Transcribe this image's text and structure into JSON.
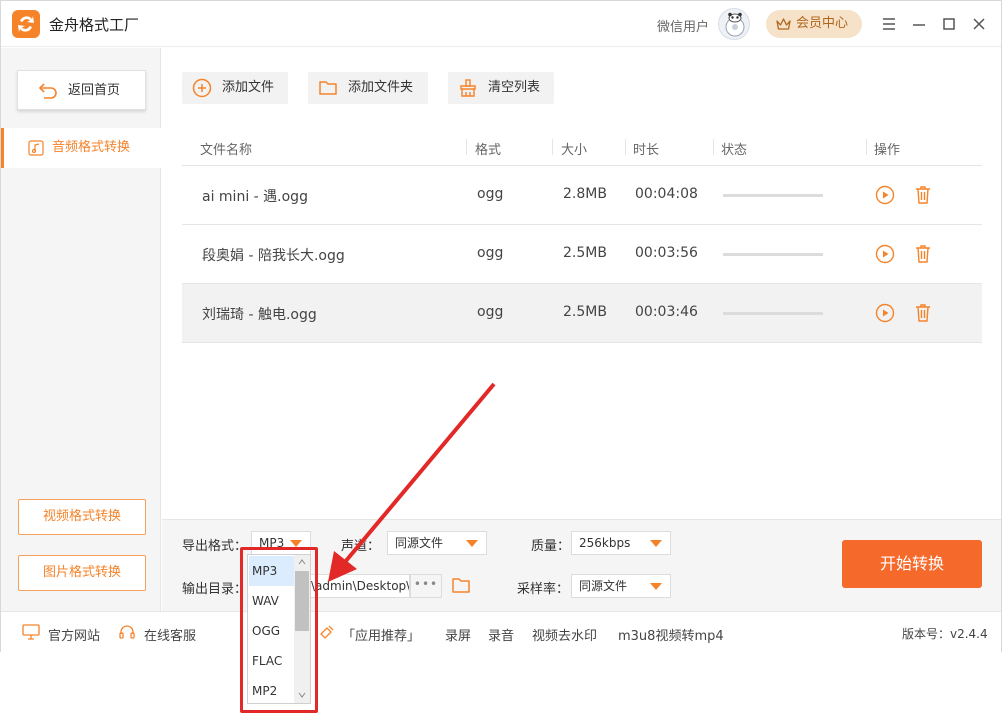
{
  "app": {
    "title": "金舟格式工厂",
    "user_name": "微信用户",
    "vip_label": "会员中心"
  },
  "sidebar": {
    "back_label": "返回首页",
    "active_label": "音频格式转换",
    "video_label": "视频格式转换",
    "image_label": "图片格式转换"
  },
  "toolbar": {
    "add_file": "添加文件",
    "add_folder": "添加文件夹",
    "clear_list": "清空列表"
  },
  "table": {
    "headers": {
      "name": "文件名称",
      "format": "格式",
      "size": "大小",
      "duration": "时长",
      "status": "状态",
      "actions": "操作"
    },
    "rows": [
      {
        "name": "ai mini - 遇.ogg",
        "format": "ogg",
        "size": "2.8MB",
        "duration": "00:04:08"
      },
      {
        "name": "段奥娟 - 陪我长大.ogg",
        "format": "ogg",
        "size": "2.5MB",
        "duration": "00:03:56"
      },
      {
        "name": "刘瑞琦 - 触电.ogg",
        "format": "ogg",
        "size": "2.5MB",
        "duration": "00:03:46"
      }
    ]
  },
  "settings": {
    "output_format_label": "导出格式：",
    "output_format_value": "MP3",
    "channel_label": "声道：",
    "channel_value": "同源文件",
    "quality_label": "质量：",
    "quality_value": "256kbps",
    "output_dir_label": "输出目录：",
    "output_dir_value": "\\admin\\Desktop\\",
    "sample_rate_label": "采样率：",
    "sample_rate_value": "同源文件",
    "start_label": "开始转换"
  },
  "format_dropdown": {
    "options": [
      "MP3",
      "WAV",
      "OGG",
      "FLAC",
      "MP2"
    ],
    "selected": "MP3"
  },
  "footer": {
    "website": "官方网站",
    "service": "在线客服",
    "recommend": "「应用推荐」",
    "links": [
      "录屏",
      "录音",
      "视频去水印",
      "m3u8视频转mp4"
    ],
    "version": "版本号：v2.4.4"
  },
  "colors": {
    "accent": "#f5832a",
    "start_button": "#f5692a",
    "annotation": "#e32828"
  }
}
